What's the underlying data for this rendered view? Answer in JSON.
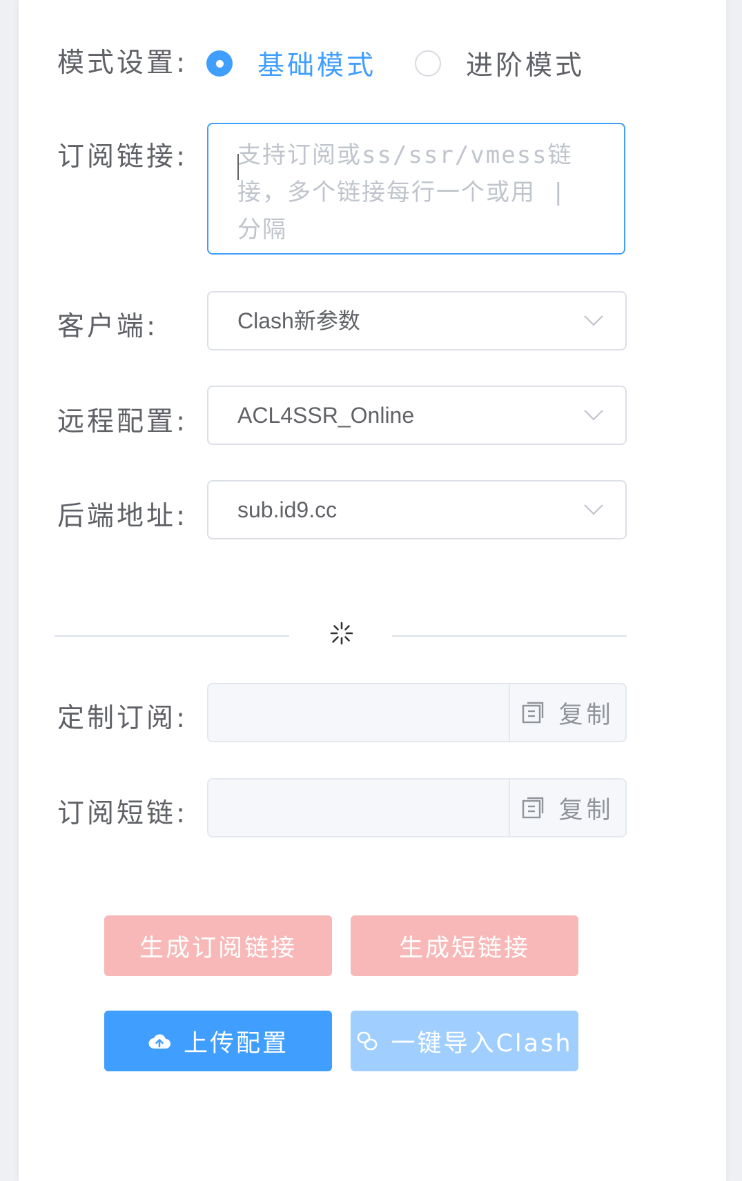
{
  "mode": {
    "label": "模式设置:",
    "options": [
      {
        "label": "基础模式",
        "checked": true
      },
      {
        "label": "进阶模式",
        "checked": false
      }
    ]
  },
  "subscription": {
    "label": "订阅链接:",
    "placeholder": "支持订阅或ss/ssr/vmess链接，多个链接每行一个或用 | 分隔",
    "value": ""
  },
  "client": {
    "label": "客户端:",
    "selected": "Clash新参数"
  },
  "remote_config": {
    "label": "远程配置:",
    "selected": "ACL4SSR_Online"
  },
  "backend": {
    "label": "后端地址:",
    "selected": "sub.id9.cc"
  },
  "custom_sub": {
    "label": "定制订阅:",
    "value": "",
    "copy_label": "复制"
  },
  "short_link": {
    "label": "订阅短链:",
    "value": "",
    "copy_label": "复制"
  },
  "actions": {
    "generate_sub": "生成订阅链接",
    "generate_short": "生成短链接",
    "upload_config": "上传配置",
    "import_clash": "一键导入Clash"
  },
  "colors": {
    "primary": "#409eff",
    "primary_light": "#a0cfff",
    "danger_light": "#f8b8b8",
    "border": "#dcdfe6",
    "placeholder": "#c0c4cc",
    "text": "#606266"
  },
  "icons": {
    "copy": "document-copy-icon",
    "upload": "cloud-upload-icon",
    "import": "link-icon",
    "divider": "loading-spinner-icon",
    "select_arrow": "chevron-down-icon"
  }
}
